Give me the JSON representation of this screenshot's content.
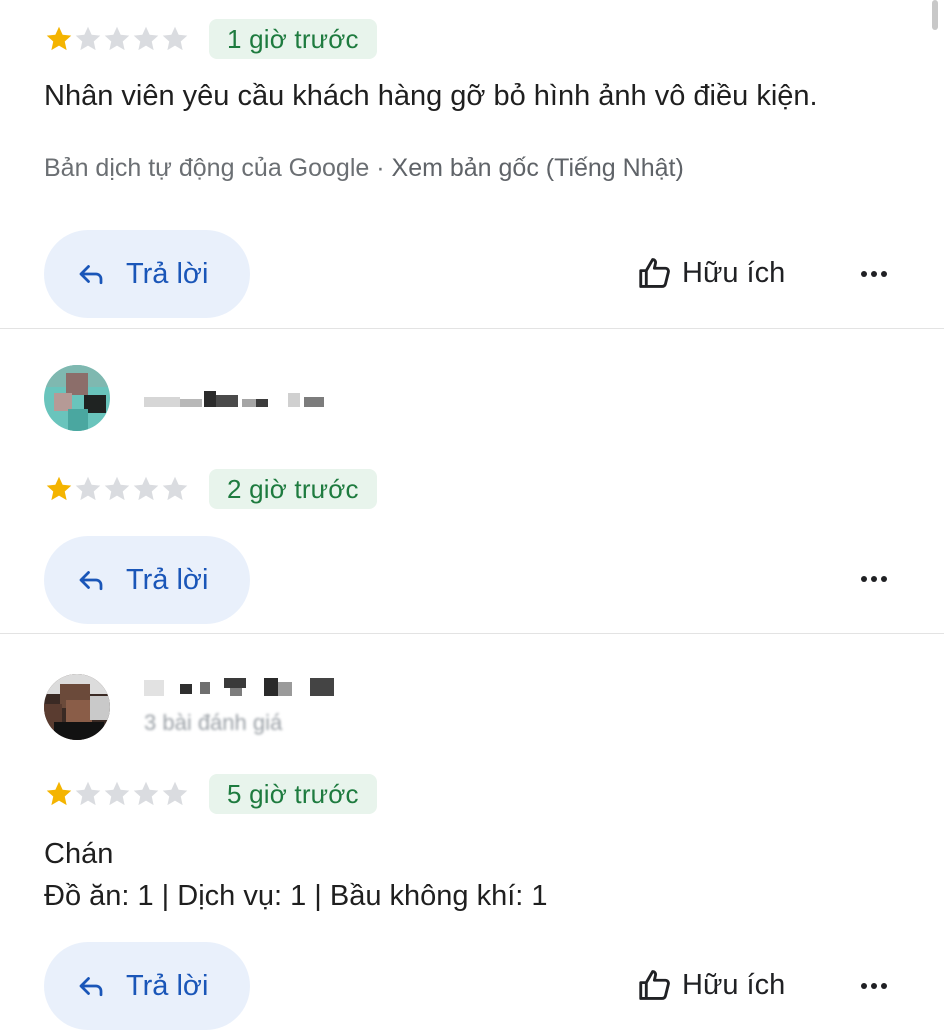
{
  "reviews": [
    {
      "rating": 1,
      "max_rating": 5,
      "time": "1 giờ trước",
      "text": "Nhân viên yêu cầu khách hàng gỡ bỏ hình ảnh vô điều kiện.",
      "translation_note": "Bản dịch tự động của Google",
      "translation_sep": " · ",
      "translation_link": "Xem bản gốc (Tiếng Nhật)",
      "reply_label": "Trả lời",
      "helpful_label": "Hữu ích"
    },
    {
      "rating": 1,
      "max_rating": 5,
      "time": "2 giờ trước",
      "reply_label": "Trả lời"
    },
    {
      "rating": 1,
      "max_rating": 5,
      "meta": "3 bài đánh giá",
      "time": "5 giờ trước",
      "text_line1": "Chán",
      "text_line2": "Đồ ăn: 1 | Dịch vụ: 1 | Bầu không khí: 1",
      "reply_label": "Trả lời",
      "helpful_label": "Hữu ích"
    }
  ],
  "colors": {
    "star_filled": "#f4b400",
    "star_empty": "#dadce0",
    "badge_bg": "#e8f4ec",
    "badge_text": "#1e7b3f",
    "reply_bg": "#e9f0fb",
    "reply_text": "#1a56b8"
  },
  "icons": {
    "star": "star-icon",
    "reply": "reply-arrow-icon",
    "helpful": "thumbs-up-icon",
    "more": "more-horizontal-icon"
  }
}
